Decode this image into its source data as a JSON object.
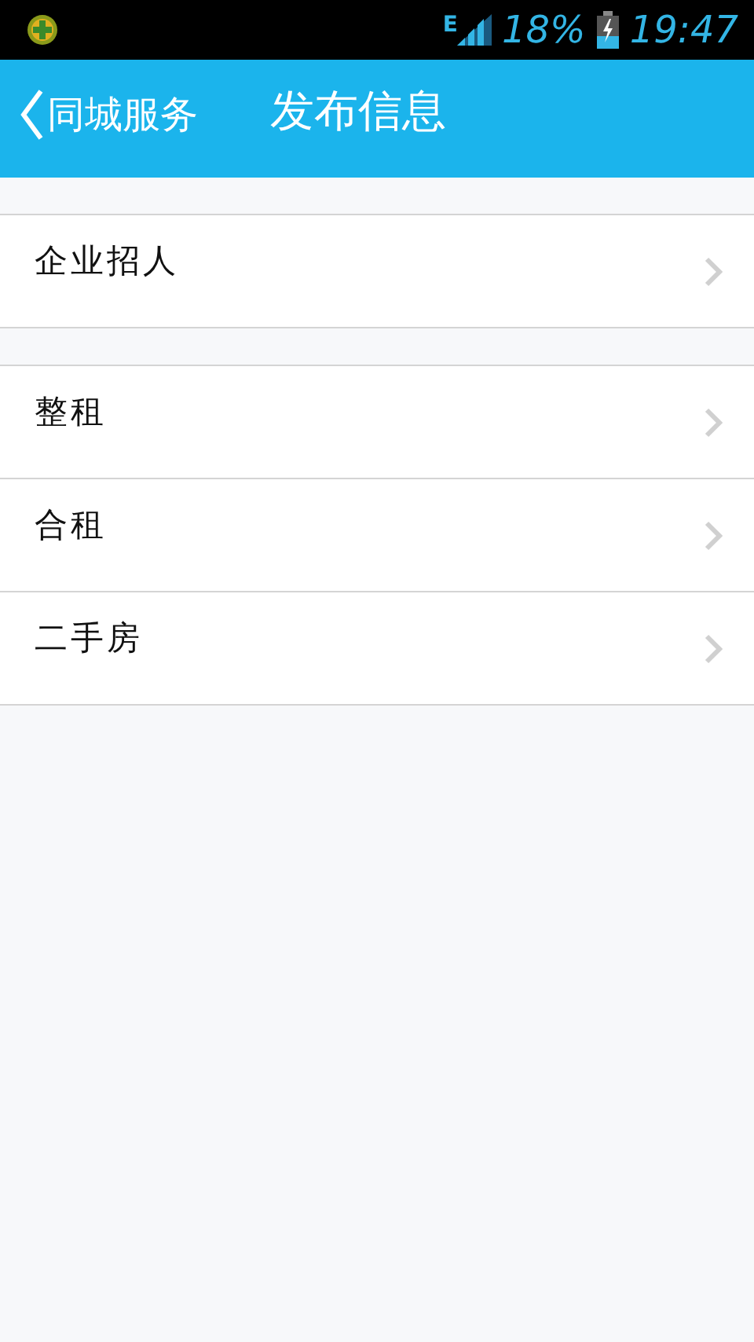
{
  "status_bar": {
    "network_type": "E",
    "battery": "18%",
    "time": "19:47"
  },
  "header": {
    "back_label": "同城服务",
    "title": "发布信息"
  },
  "groups": [
    {
      "items": [
        {
          "label": "企业招人"
        }
      ]
    },
    {
      "items": [
        {
          "label": "整租"
        },
        {
          "label": "合租"
        },
        {
          "label": "二手房"
        }
      ]
    }
  ]
}
